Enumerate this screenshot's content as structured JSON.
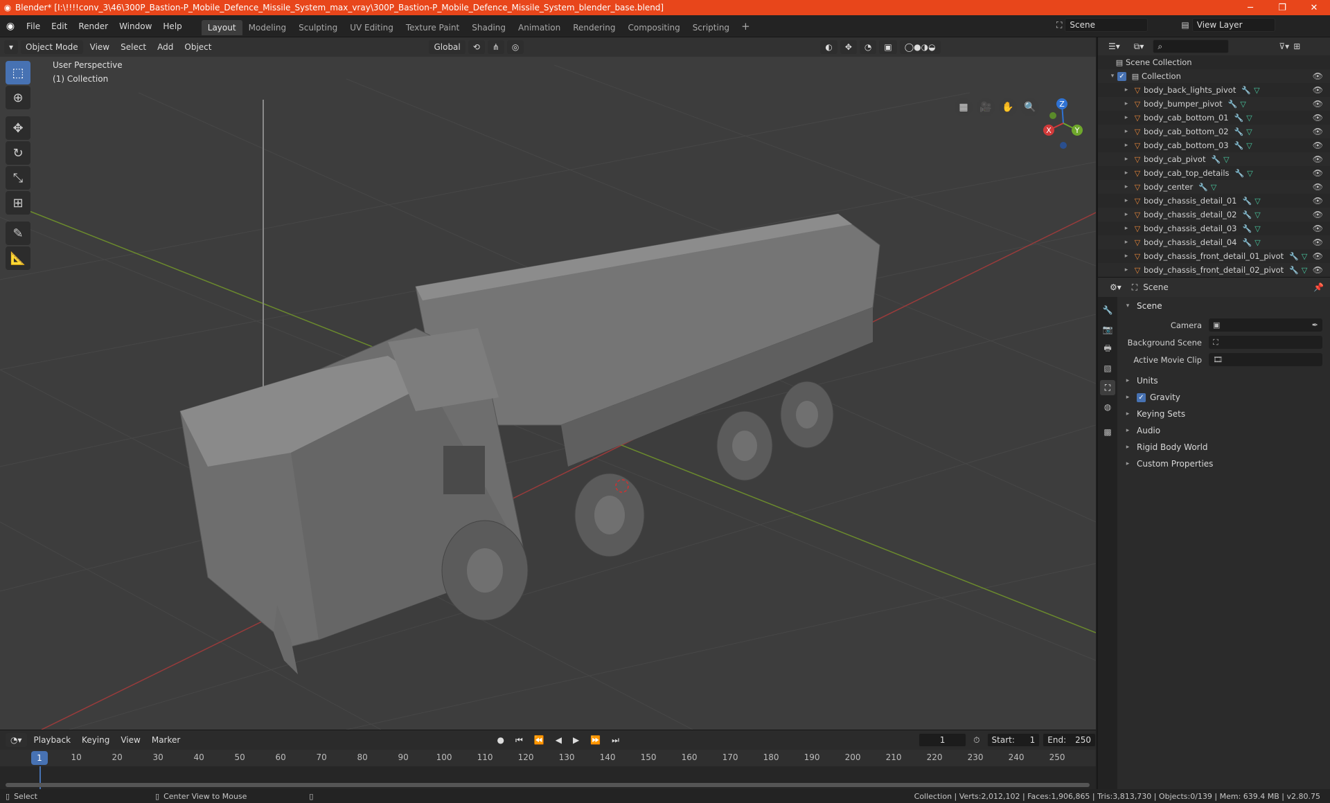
{
  "window": {
    "title": "Blender* [I:\\!!!!conv_3\\46\\300P_Bastion-P_Mobile_Defence_Missile_System_max_vray\\300P_Bastion-P_Mobile_Defence_Missile_System_blender_base.blend]",
    "controls": [
      "─",
      "❐",
      "✕"
    ]
  },
  "menus": [
    "File",
    "Edit",
    "Render",
    "Window",
    "Help"
  ],
  "workspaces": [
    "Layout",
    "Modeling",
    "Sculpting",
    "UV Editing",
    "Texture Paint",
    "Shading",
    "Animation",
    "Rendering",
    "Compositing",
    "Scripting"
  ],
  "active_workspace": "Layout",
  "scene_name": "Scene",
  "view_layer": "View Layer",
  "viewport": {
    "mode": "Object Mode",
    "menu": [
      "View",
      "Select",
      "Add",
      "Object"
    ],
    "orientation": "Global",
    "info_line1": "User Perspective",
    "info_line2": "(1) Collection",
    "gizmo": {
      "z": "Z",
      "y": "Y",
      "x": "X"
    }
  },
  "timeline": {
    "menus": [
      "Playback",
      "Keying",
      "View",
      "Marker"
    ],
    "current_frame": "1",
    "start_label": "Start:",
    "start": "1",
    "end_label": "End:",
    "end": "250",
    "ticks": [
      "10",
      "20",
      "30",
      "40",
      "50",
      "60",
      "70",
      "80",
      "90",
      "100",
      "110",
      "120",
      "130",
      "140",
      "150",
      "160",
      "170",
      "180",
      "190",
      "200",
      "210",
      "220",
      "230",
      "240",
      "250"
    ]
  },
  "status": {
    "left1": "Select",
    "left2": "Center View to Mouse",
    "right": "Collection | Verts:2,012,102 | Faces:1,906,865 | Tris:3,813,730 | Objects:0/139 | Mem: 639.4 MB | v2.80.75"
  },
  "outliner": {
    "root": "Scene Collection",
    "collection": "Collection",
    "items": [
      "body_back_lights_pivot",
      "body_bumper_pivot",
      "body_cab_bottom_01",
      "body_cab_bottom_02",
      "body_cab_bottom_03",
      "body_cab_pivot",
      "body_cab_top_details",
      "body_center",
      "body_chassis_detail_01",
      "body_chassis_detail_02",
      "body_chassis_detail_03",
      "body_chassis_detail_04",
      "body_chassis_front_detail_01_pivot",
      "body_chassis_front_detail_02_pivot"
    ]
  },
  "properties": {
    "header": "Scene",
    "panel": "Scene",
    "camera_label": "Camera",
    "background_label": "Background Scene",
    "movieclip_label": "Active Movie Clip",
    "subpanels": [
      "Units",
      "Gravity",
      "Keying Sets",
      "Audio",
      "Rigid Body World",
      "Custom Properties"
    ]
  },
  "colors": {
    "accent": "#4772b3",
    "titlebar": "#e8461b",
    "object": "#e8873a"
  }
}
